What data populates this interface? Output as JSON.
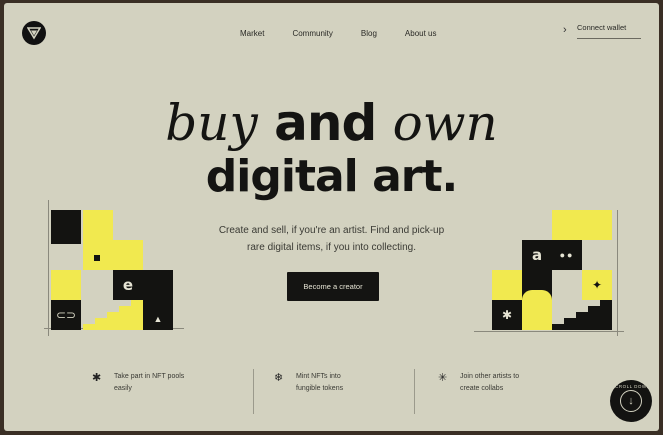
{
  "nav": {
    "items": [
      {
        "label": "Market"
      },
      {
        "label": "Community"
      },
      {
        "label": "Blog"
      },
      {
        "label": "About us"
      }
    ],
    "wallet_label": "Connect wallet"
  },
  "hero": {
    "word1": "buy",
    "word2": " and ",
    "word3": "own",
    "line2": "digital art.",
    "subtitle_line1": "Create and sell, if you're an artist. Find and pick-up",
    "subtitle_line2": "rare digital items, if you into collecting.",
    "cta_label": "Become a creator"
  },
  "blocks": {
    "left_e": "e",
    "right_a": "a"
  },
  "features": [
    {
      "line1": "Take part in NFT pools",
      "line2": "easily"
    },
    {
      "line1": "Mint NFTs into",
      "line2": "fungible tokens"
    },
    {
      "line1": "Join other artists to",
      "line2": "create collabs"
    }
  ],
  "badge": {
    "text": "SCROLL DOWN"
  },
  "colors": {
    "background": "#d3d2c0",
    "yellow": "#f1e94f",
    "black": "#131311"
  }
}
